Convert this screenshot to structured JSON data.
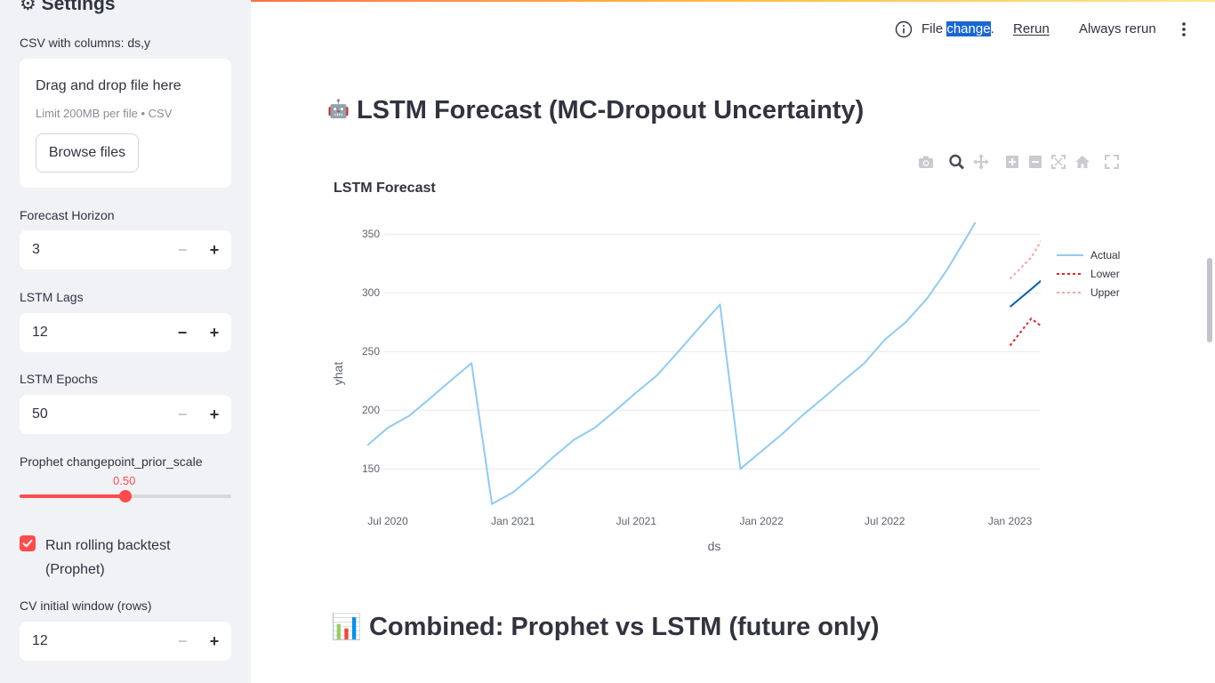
{
  "sidebar": {
    "title": "⚙ Settings",
    "csv_label": "CSV with columns: ds,y",
    "uploader": {
      "title": "Drag and drop file here",
      "subtitle": "Limit 200MB per file • CSV",
      "button": "Browse files"
    },
    "forecast_horizon": {
      "label": "Forecast Horizon",
      "value": "3"
    },
    "lstm_lags": {
      "label": "LSTM Lags",
      "value": "12"
    },
    "lstm_epochs": {
      "label": "LSTM Epochs",
      "value": "50"
    },
    "changepoint": {
      "label": "Prophet changepoint_prior_scale",
      "value": "0.50",
      "fraction": 0.5
    },
    "backtest": {
      "label": "Run rolling backtest (Prophet)",
      "checked": true
    },
    "cv_window": {
      "label": "CV initial window (rows)",
      "value": "12"
    }
  },
  "header": {
    "file_prefix": "File ",
    "file_highlight": "change",
    "file_suffix": ".",
    "rerun": "Rerun",
    "always_rerun": "Always rerun"
  },
  "sections": {
    "lstm_title": "LSTM Forecast (MC-Dropout Uncertainty)",
    "lstm_icon": "🤖",
    "combined_title": "Combined: Prophet vs LSTM (future only)",
    "combined_icon": "📊"
  },
  "colors": {
    "actual": "#8ecbf5",
    "forecast": "#0a5fb4",
    "lower": "#e02424",
    "upper": "#f4a5a0",
    "accent": "#ff4b4b"
  },
  "chart_data": {
    "type": "line",
    "title": "LSTM Forecast",
    "xlabel": "ds",
    "ylabel": "yhat",
    "x_ticks": [
      "Jul 2020",
      "Jan 2021",
      "Jul 2021",
      "Jan 2022",
      "Jul 2022",
      "Jan 2023"
    ],
    "y_ticks": [
      150,
      200,
      250,
      300,
      350
    ],
    "ylim": [
      110,
      360
    ],
    "xlim": [
      "2020-06-01",
      "2023-02-15"
    ],
    "legend_position": "top-right",
    "series": [
      {
        "name": "Actual",
        "style": "solid",
        "x": [
          "2020-06-01",
          "2020-07-01",
          "2020-08-01",
          "2020-09-01",
          "2020-10-01",
          "2020-11-01",
          "2020-12-01",
          "2021-01-01",
          "2021-02-01",
          "2021-03-01",
          "2021-04-01",
          "2021-05-01",
          "2021-06-01",
          "2021-07-01",
          "2021-08-01",
          "2021-09-01",
          "2021-10-01",
          "2021-11-01",
          "2021-12-01",
          "2022-01-01",
          "2022-02-01",
          "2022-03-01",
          "2022-04-01",
          "2022-05-01",
          "2022-06-01",
          "2022-07-01",
          "2022-08-01",
          "2022-09-01",
          "2022-10-01",
          "2022-11-01",
          "2022-12-01"
        ],
        "values": [
          170,
          185,
          195,
          210,
          225,
          240,
          120,
          130,
          145,
          160,
          175,
          185,
          200,
          215,
          230,
          250,
          270,
          290,
          150,
          165,
          180,
          195,
          210,
          225,
          240,
          260,
          275,
          295,
          320,
          350,
          380
        ]
      },
      {
        "name": "",
        "style": "solid",
        "x": [
          "2023-01-01",
          "2023-02-01",
          "2023-03-01"
        ],
        "values": [
          288,
          303,
          317
        ]
      },
      {
        "name": "Lower",
        "style": "dotted",
        "x": [
          "2023-01-01",
          "2023-02-01",
          "2023-03-01"
        ],
        "values": [
          255,
          278,
          266
        ]
      },
      {
        "name": "Upper",
        "style": "dotted",
        "x": [
          "2023-01-01",
          "2023-02-01",
          "2023-03-01"
        ],
        "values": [
          312,
          330,
          357
        ]
      }
    ]
  }
}
